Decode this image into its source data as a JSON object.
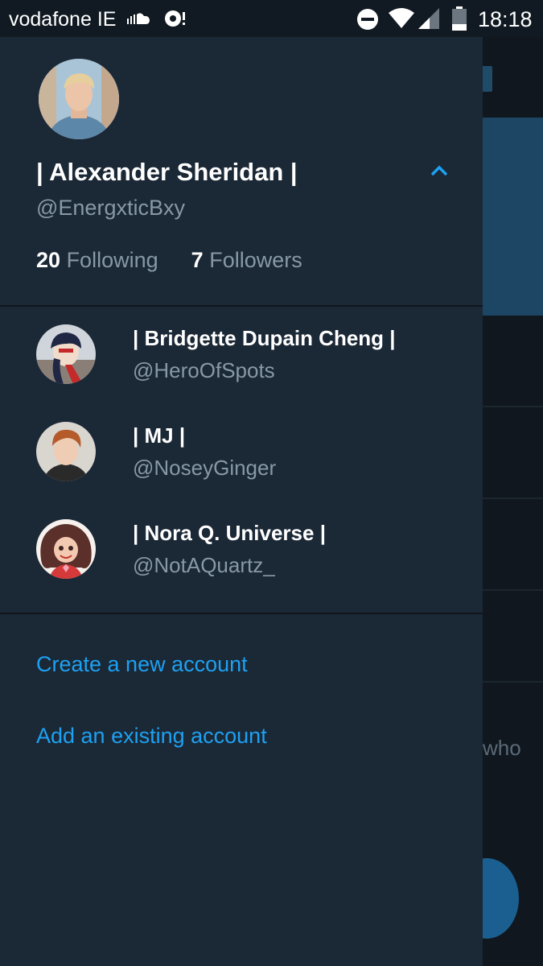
{
  "status_bar": {
    "carrier": "vodafone IE",
    "time": "18:18",
    "icons": [
      "soundcloud-icon",
      "alarm-icon",
      "do-not-disturb-icon",
      "wifi-icon",
      "cell-signal-icon",
      "battery-icon"
    ]
  },
  "background": {
    "partial_text": "who"
  },
  "profile": {
    "name": "| Alexander Sheridan |",
    "handle": "@EnergxticBxy",
    "following_count": "20",
    "following_label": "Following",
    "followers_count": "7",
    "followers_label": "Followers"
  },
  "accounts": [
    {
      "name": "| Bridgette Dupain Cheng |",
      "handle": "@HeroOfSpots"
    },
    {
      "name": "| MJ |",
      "handle": "@NoseyGinger"
    },
    {
      "name": "| Nora Q. Universe |",
      "handle": "@NotAQuartz_"
    }
  ],
  "actions": {
    "create_account": "Create a new account",
    "add_account": "Add an existing account"
  },
  "colors": {
    "drawer_bg": "#1b2836",
    "accent": "#1da1f2",
    "muted_text": "#8899a6",
    "background_app": "#10171e"
  }
}
